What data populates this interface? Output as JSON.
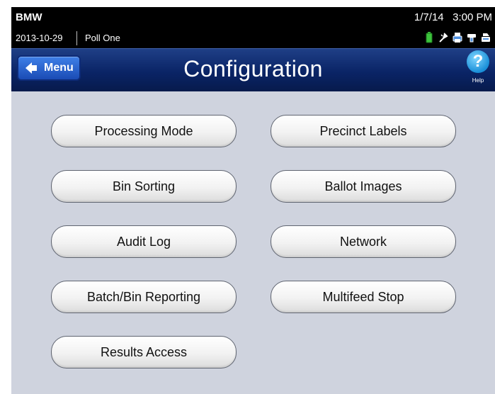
{
  "status_bar": {
    "device": "BMW",
    "date": "2013-10-29",
    "poll": "Poll One",
    "datetime": "1/7/14   3:00 PM",
    "icons": [
      "battery-icon",
      "power-plug-icon",
      "printer-icon",
      "flash-drive-icon",
      "scanner-icon"
    ]
  },
  "header": {
    "menu_label": "Menu",
    "title": "Configuration",
    "help_label": "Help",
    "help_glyph": "?"
  },
  "buttons": {
    "processing_mode": "Processing Mode",
    "precinct_labels": "Precinct Labels",
    "bin_sorting": "Bin Sorting",
    "ballot_images": "Ballot Images",
    "audit_log": "Audit Log",
    "network": "Network",
    "batch_bin_reporting": "Batch/Bin Reporting",
    "multifeed_stop": "Multifeed Stop",
    "results_access": "Results Access"
  },
  "colors": {
    "title_bar": "#0a2466",
    "menu_button": "#2a62d0",
    "content_bg": "#cfd3de",
    "battery": "#3cc33c"
  }
}
